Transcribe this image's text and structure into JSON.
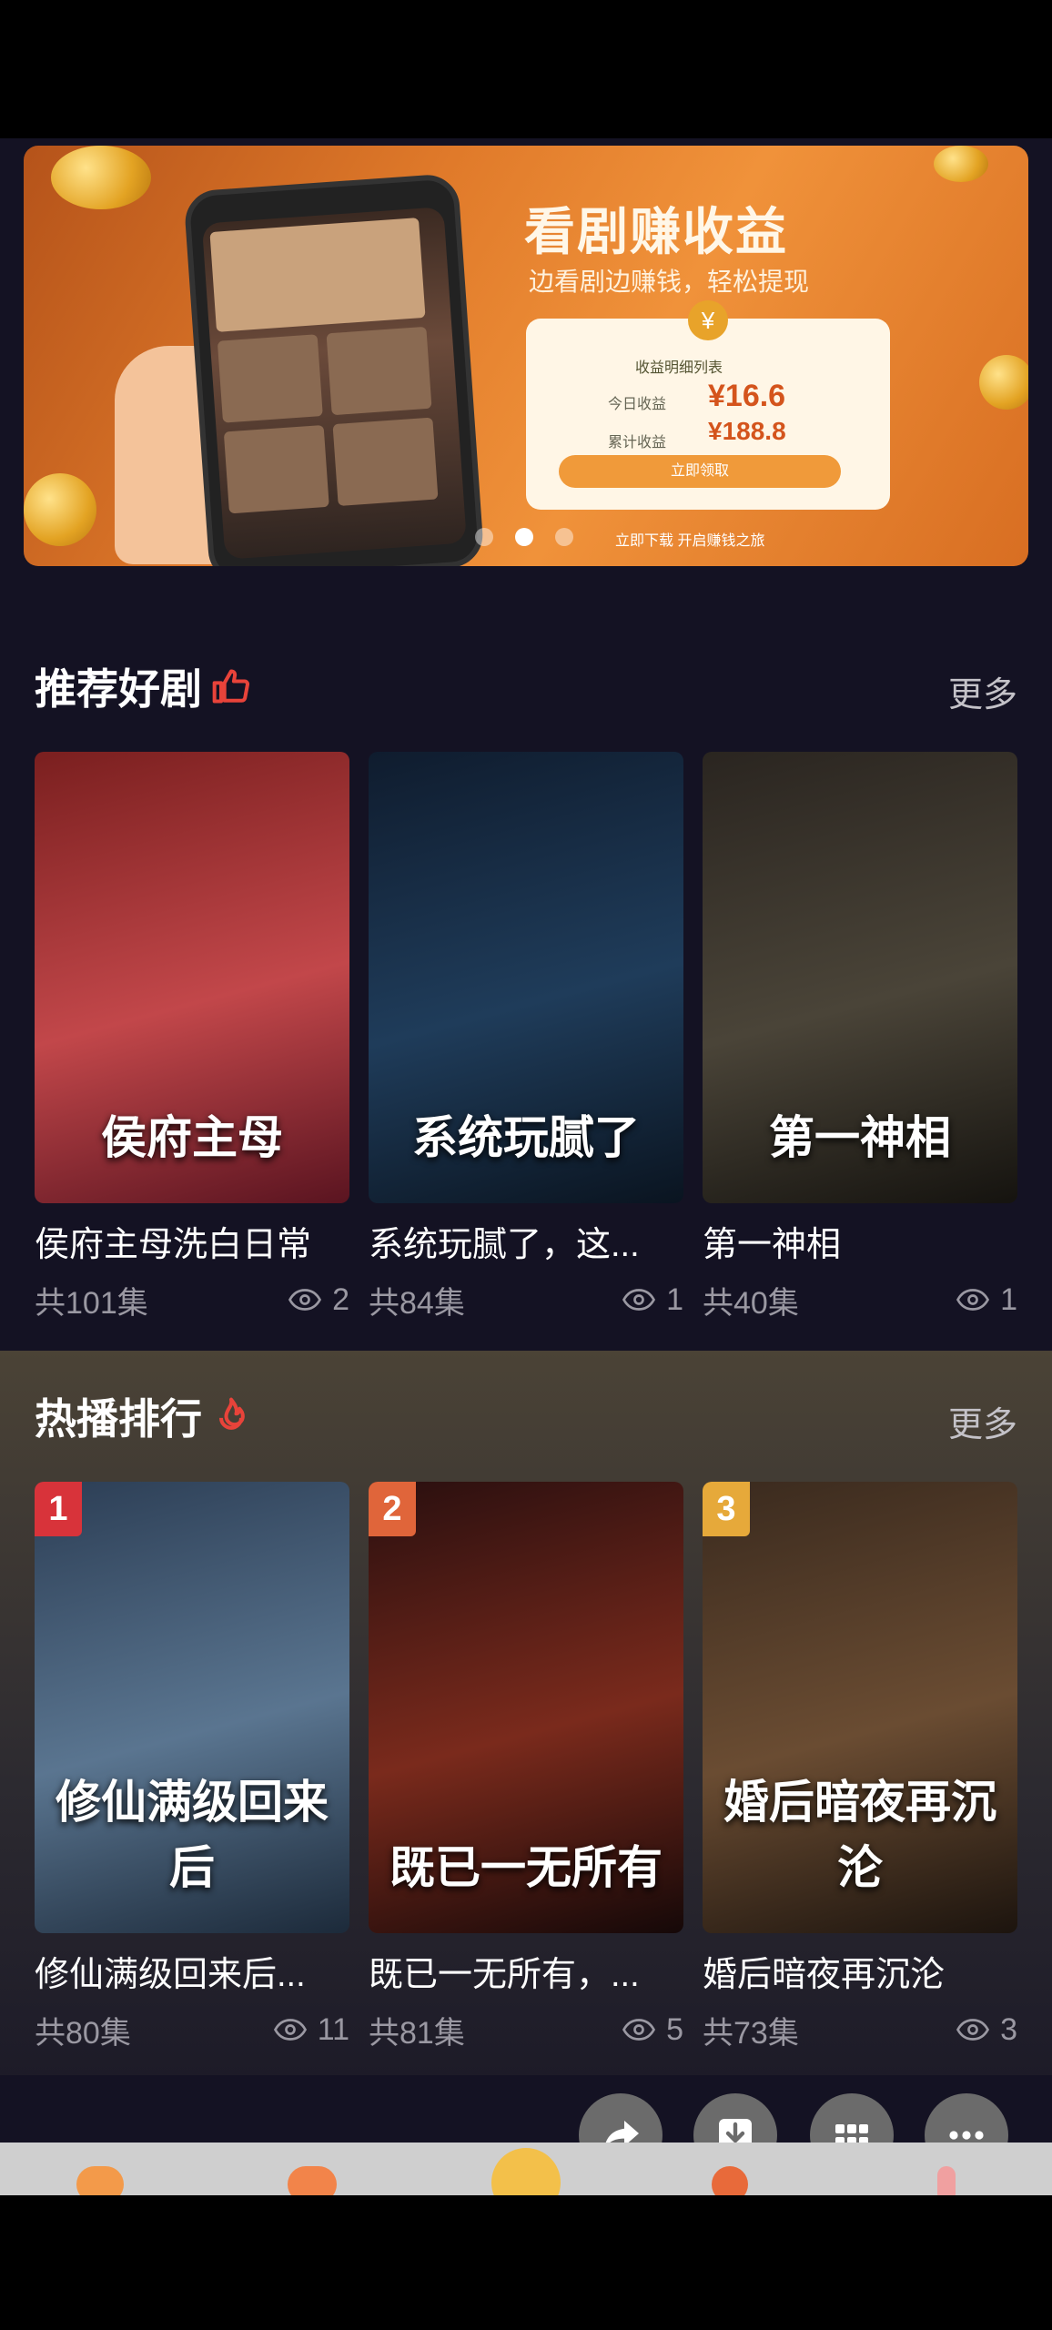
{
  "banner": {
    "title": "看剧赚收益",
    "subtitle": "边看剧边赚钱，轻松提现",
    "card_title": "收益明细列表",
    "today_label": "今日收益",
    "today_value": "¥16.6",
    "total_label": "累计收益",
    "total_value": "¥188.8",
    "card_button": "立即领取",
    "footer_text": "立即下载  开启赚钱之旅",
    "page_count": 3,
    "active_page": 2
  },
  "recommend": {
    "title": "推荐好剧",
    "more": "更多",
    "icon": "thumbs-up-icon",
    "items": [
      {
        "poster_text": "侯府主母",
        "name": "侯府主母洗白日常",
        "episodes": "共101集",
        "views": "2",
        "colors": [
          "#7a1f1f",
          "#c2474a",
          "#5a1420"
        ]
      },
      {
        "poster_text": "系统玩腻了",
        "name": "系统玩腻了，这...",
        "episodes": "共84集",
        "views": "1",
        "colors": [
          "#0f1c2e",
          "#1f3c5a",
          "#0a1420"
        ]
      },
      {
        "poster_text": "第一神相",
        "name": "第一神相",
        "episodes": "共40集",
        "views": "1",
        "colors": [
          "#2a2520",
          "#4a4438",
          "#15130f"
        ]
      }
    ]
  },
  "hot": {
    "title": "热播排行",
    "more": "更多",
    "icon": "flame-icon",
    "items": [
      {
        "rank": "1",
        "rank_color": "#d8333a",
        "poster_text": "修仙满级回来后",
        "name": "修仙满级回来后...",
        "episodes": "共80集",
        "views": "11",
        "colors": [
          "#2c3e55",
          "#5a7590",
          "#1c2a3a"
        ]
      },
      {
        "rank": "2",
        "rank_color": "#e0653a",
        "poster_text": "既已一无所有",
        "name": "既已一无所有，...",
        "episodes": "共81集",
        "views": "5",
        "colors": [
          "#2a0f0f",
          "#7a2a1c",
          "#150808"
        ]
      },
      {
        "rank": "3",
        "rank_color": "#e6a93a",
        "poster_text": "婚后暗夜再沉沦",
        "name": "婚后暗夜再沉沦",
        "episodes": "共73集",
        "views": "3",
        "colors": [
          "#3a2a1e",
          "#6a4c32",
          "#1c140e"
        ]
      }
    ]
  },
  "fabs": [
    "share-icon",
    "download-icon",
    "grid-icon",
    "more-icon"
  ],
  "colors": {
    "accent": "#e8433a",
    "background": "#141223"
  }
}
